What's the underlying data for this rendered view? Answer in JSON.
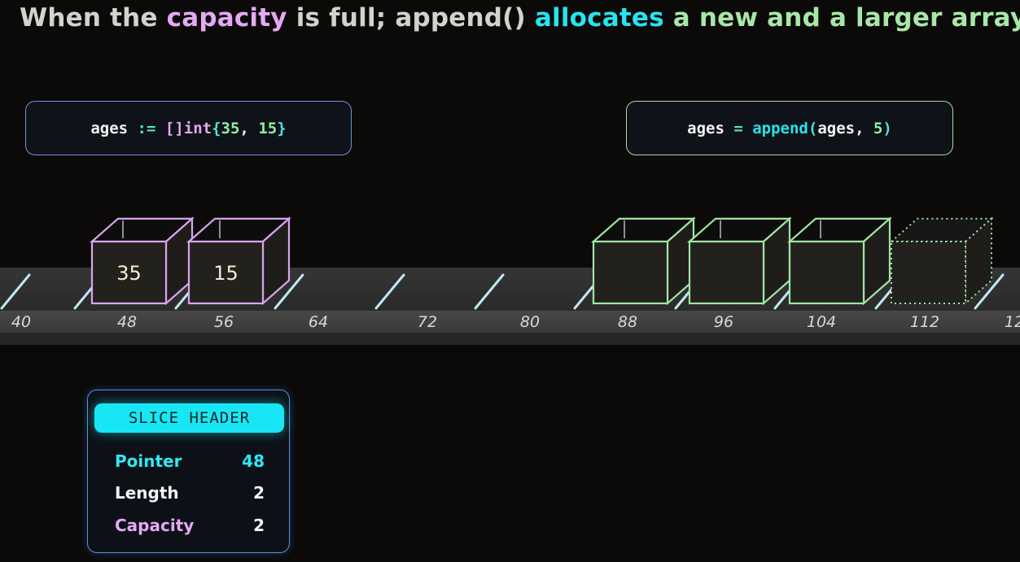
{
  "title": {
    "parts": [
      {
        "text": "When the ",
        "color": "#d4d2ce"
      },
      {
        "text": "capacity",
        "color": "#e4a9f4"
      },
      {
        "text": " is full; append() ",
        "color": "#d4d2ce"
      },
      {
        "text": "allocates",
        "color": "#27e3ee"
      },
      {
        "text": " a new and a larger array",
        "color": "#a7e8a8"
      }
    ]
  },
  "code_left": {
    "tokens": [
      {
        "text": "ages ",
        "cls": "tok-w"
      },
      {
        "text": ":= ",
        "cls": "tok-op"
      },
      {
        "text": "[]int",
        "cls": "tok-type"
      },
      {
        "text": "{",
        "cls": "tok-op"
      },
      {
        "text": "35",
        "cls": "tok-num"
      },
      {
        "text": ", ",
        "cls": "tok-w"
      },
      {
        "text": "15",
        "cls": "tok-num"
      },
      {
        "text": "}",
        "cls": "tok-op"
      }
    ]
  },
  "code_right": {
    "tokens": [
      {
        "text": "ages ",
        "cls": "tok-w"
      },
      {
        "text": "= ",
        "cls": "tok-op"
      },
      {
        "text": "append",
        "cls": "tok-fn"
      },
      {
        "text": "(",
        "cls": "tok-op"
      },
      {
        "text": "ages",
        "cls": "tok-w"
      },
      {
        "text": ", ",
        "cls": "tok-w"
      },
      {
        "text": "5",
        "cls": "tok-num"
      },
      {
        "text": ")",
        "cls": "tok-op"
      }
    ]
  },
  "memory": {
    "addresses": [
      "40",
      "48",
      "56",
      "64",
      "72",
      "80",
      "88",
      "96",
      "104",
      "112",
      "12"
    ],
    "old_array": {
      "values": [
        "35",
        "15"
      ],
      "color": "#d9a4ee"
    },
    "new_array": {
      "values": [
        "",
        "",
        ""
      ],
      "reserved_slots": 1,
      "color": "#9fe5a2"
    }
  },
  "slice_header": {
    "title": "SLICE HEADER",
    "rows": [
      {
        "label": "Pointer",
        "value": "48",
        "color": "#2ee8f2"
      },
      {
        "label": "Length",
        "value": "2",
        "color": "#f4f4f4"
      },
      {
        "label": "Capacity",
        "value": "2",
        "color": "#e4a9f4"
      }
    ]
  }
}
